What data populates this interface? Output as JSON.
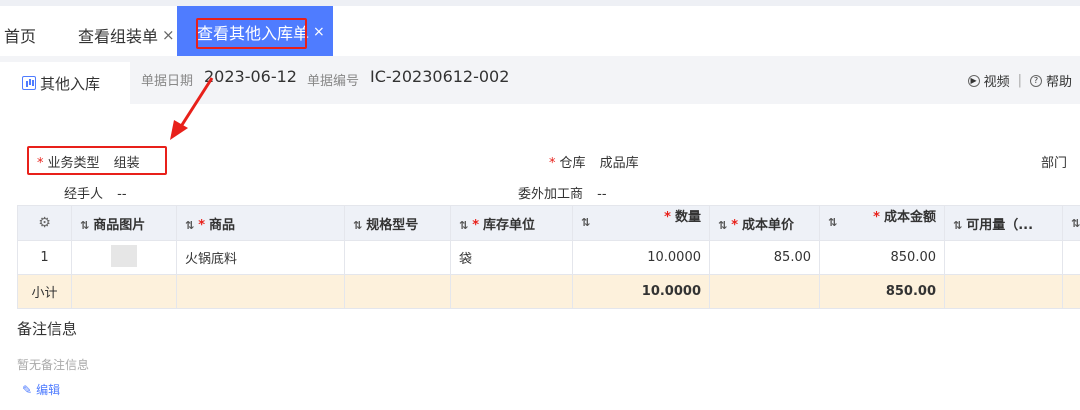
{
  "tabs": {
    "home": "首页",
    "assembly": "查看组装单",
    "active": "查看其他入库单",
    "close_glyph": "×"
  },
  "header": {
    "title": "其他入库",
    "date_label": "单据日期",
    "date_value": "2023-06-12",
    "no_label": "单据编号",
    "no_value": "IC-20230612-002",
    "video": "视频",
    "sep": "|",
    "help": "帮助"
  },
  "form": {
    "required_mark": "*",
    "biz_type_label": "业务类型",
    "biz_type_value": "组装",
    "warehouse_label": "仓库",
    "warehouse_value": "成品库",
    "dept_label": "部门",
    "handler_label": "经手人",
    "handler_value": "--",
    "processor_label": "委外加工商",
    "processor_value": "--"
  },
  "table": {
    "columns": {
      "image": "商品图片",
      "product": "商品",
      "spec": "规格型号",
      "unit": "库存单位",
      "qty": "数量",
      "unit_cost": "成本单价",
      "cost_amount": "成本金额",
      "available": "可用量（..."
    },
    "row": {
      "index": "1",
      "product": "火锅底料",
      "spec": "",
      "unit": "袋",
      "qty": "10.0000",
      "unit_cost": "85.00",
      "cost_amount": "850.00",
      "available": ""
    },
    "subtotal": {
      "label": "小计",
      "qty": "10.0000",
      "cost_amount": "850.00"
    }
  },
  "notes": {
    "title": "备注信息",
    "empty": "暂无备注信息",
    "edit": "编辑"
  },
  "colors": {
    "accent": "#4f7cff",
    "highlight": "#e8201a",
    "subtotal_bg": "#fdf1dc"
  }
}
